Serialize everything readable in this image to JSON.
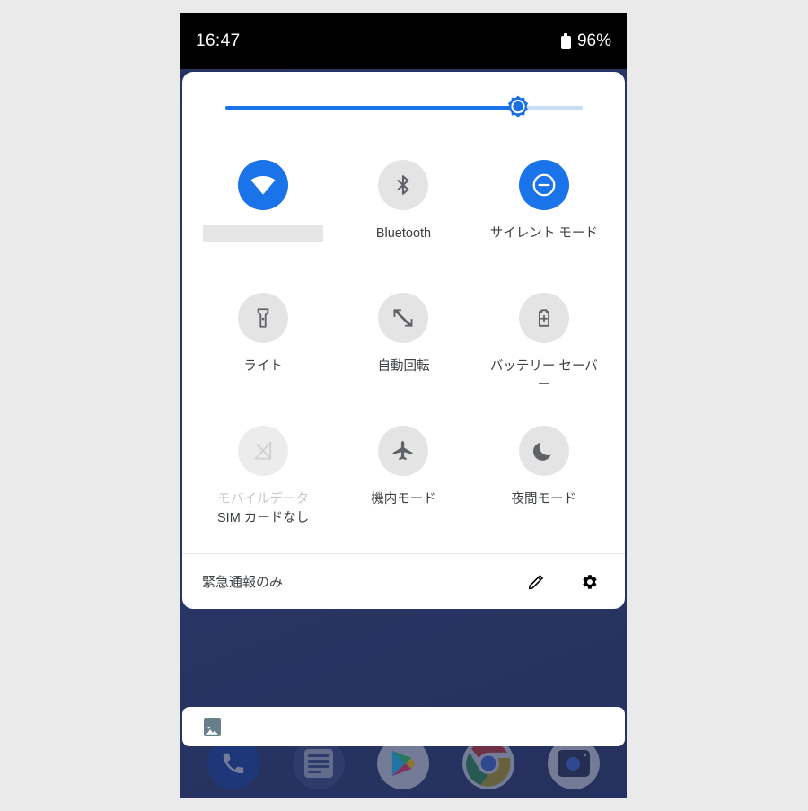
{
  "status_bar": {
    "clock": "16:47",
    "battery_percent": "96%",
    "battery_icon": "battery-full-icon"
  },
  "brightness": {
    "name": "brightness-slider",
    "value_percent": 82,
    "thumb_icon": "brightness-sun-icon",
    "fill_color": "#1a73e8",
    "track_color": "#c9ddf8"
  },
  "quick_settings": {
    "tiles": [
      {
        "name": "wifi",
        "icon": "wifi-icon",
        "label": "",
        "label_is_placeholder": true,
        "state": "active"
      },
      {
        "name": "bluetooth",
        "icon": "bluetooth-icon",
        "label": "Bluetooth",
        "state": "inactive"
      },
      {
        "name": "silent-mode",
        "icon": "do-not-disturb-icon",
        "label": "サイレント モード",
        "state": "active"
      },
      {
        "name": "flashlight",
        "icon": "flashlight-icon",
        "label": "ライト",
        "state": "inactive"
      },
      {
        "name": "auto-rotate",
        "icon": "auto-rotate-icon",
        "label": "自動回転",
        "state": "inactive"
      },
      {
        "name": "battery-saver",
        "icon": "battery-saver-icon",
        "label": "バッテリー セーバー",
        "state": "inactive"
      },
      {
        "name": "mobile-data",
        "icon": "mobile-data-off-icon",
        "label": "モバイルデータ",
        "sublabel": "SIM カードなし",
        "state": "disabled"
      },
      {
        "name": "airplane-mode",
        "icon": "airplane-icon",
        "label": "機内モード",
        "state": "inactive"
      },
      {
        "name": "night-mode",
        "icon": "moon-icon",
        "label": "夜間モード",
        "state": "inactive"
      }
    ],
    "footer": {
      "carrier_text": "緊急通報のみ",
      "edit_icon": "pencil-icon",
      "settings_icon": "gear-icon"
    }
  },
  "notification": {
    "icon": "image-icon"
  },
  "dock": {
    "apps": [
      {
        "name": "phone",
        "icon": "phone-icon"
      },
      {
        "name": "messages",
        "icon": "messages-icon"
      },
      {
        "name": "play-store",
        "icon": "play-store-icon"
      },
      {
        "name": "chrome",
        "icon": "chrome-icon"
      },
      {
        "name": "camera",
        "icon": "camera-icon"
      }
    ]
  },
  "colors": {
    "accent": "#1a73e8",
    "panel_background": "#ffffff",
    "status_bar_background": "#000000",
    "wallpaper": "#2e3c6e",
    "tile_inactive": "#e4e4e4"
  }
}
